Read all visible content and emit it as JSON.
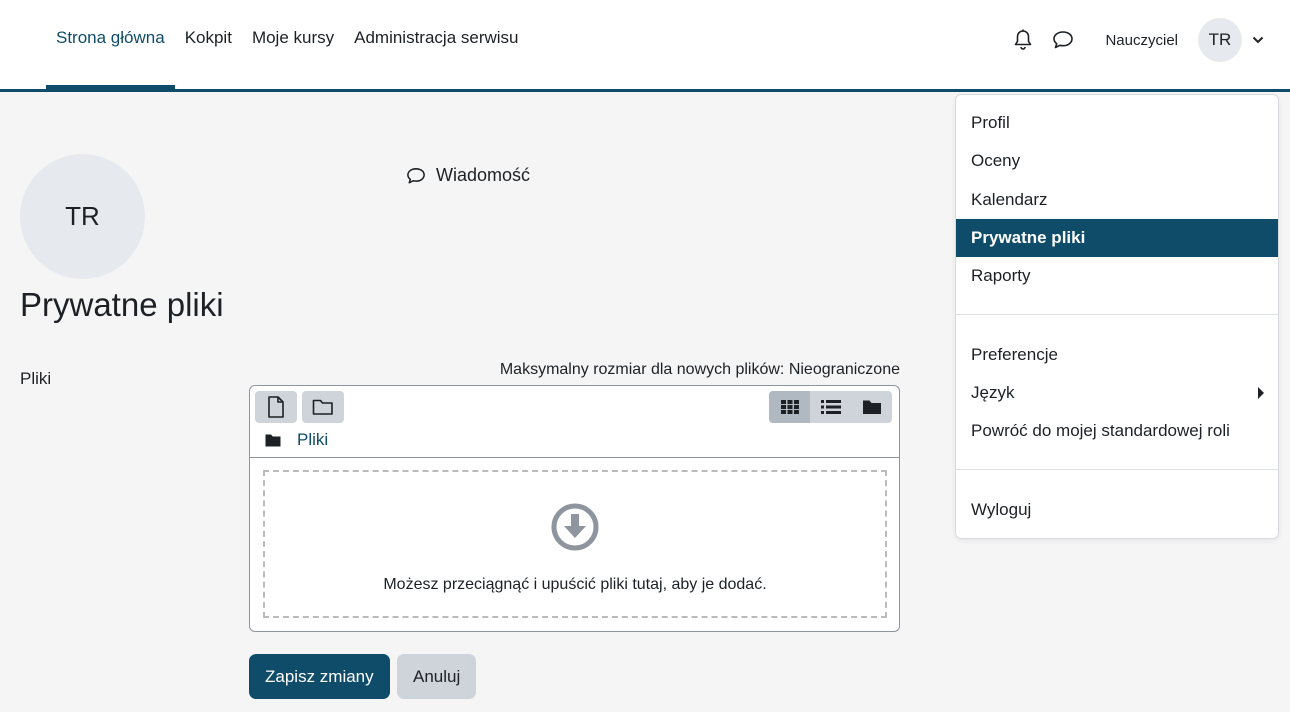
{
  "nav": {
    "links": [
      "Strona główna",
      "Kokpit",
      "Moje kursy",
      "Administracja serwisu"
    ],
    "user_name": "Nauczyciel",
    "user_initials": "TR"
  },
  "header": {
    "initials": "TR",
    "message_label": "Wiadomość",
    "page_title": "Prywatne pliki"
  },
  "form": {
    "files_label": "Pliki",
    "max_size": "Maksymalny rozmiar dla nowych plików: Nieograniczone",
    "path_label": "Pliki",
    "drop_text": "Możesz przeciągnąć i upuścić pliki tutaj, aby je dodać.",
    "save_label": "Zapisz zmiany",
    "cancel_label": "Anuluj"
  },
  "dropdown": {
    "items": [
      "Profil",
      "Oceny",
      "Kalendarz",
      "Prywatne pliki",
      "Raporty",
      "Preferencje",
      "Język",
      "Powróć do mojej standardowej roli",
      "Wyloguj"
    ],
    "active_item": "Prywatne pliki"
  },
  "colors": {
    "primary": "#0f4c69",
    "background": "#f5f5f5",
    "avatar_bg": "#e6eaee",
    "secondary_button": "#ced4da"
  }
}
